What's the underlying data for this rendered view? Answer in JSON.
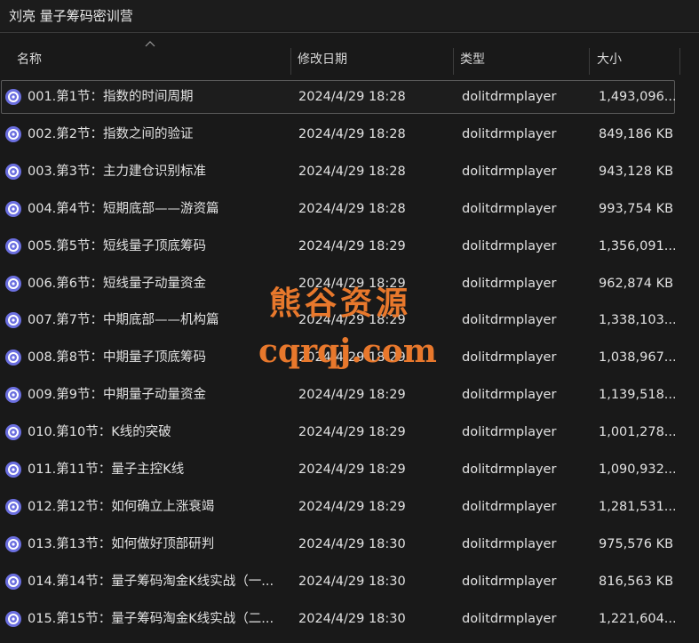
{
  "window": {
    "title": "刘亮 量子筹码密训营"
  },
  "columns": {
    "name": "名称",
    "date": "修改日期",
    "type": "类型",
    "size": "大小"
  },
  "files": [
    {
      "name": "001.第1节：指数的时间周期",
      "date": "2024/4/29 18:28",
      "type": "dolitdrmplayer",
      "size": "1,493,096...",
      "selected": true
    },
    {
      "name": "002.第2节：指数之间的验证",
      "date": "2024/4/29 18:28",
      "type": "dolitdrmplayer",
      "size": "849,186 KB"
    },
    {
      "name": "003.第3节：主力建仓识别标准",
      "date": "2024/4/29 18:28",
      "type": "dolitdrmplayer",
      "size": "943,128 KB"
    },
    {
      "name": "004.第4节：短期底部——游资篇",
      "date": "2024/4/29 18:28",
      "type": "dolitdrmplayer",
      "size": "993,754 KB"
    },
    {
      "name": "005.第5节：短线量子顶底筹码",
      "date": "2024/4/29 18:29",
      "type": "dolitdrmplayer",
      "size": "1,356,091..."
    },
    {
      "name": "006.第6节：短线量子动量资金",
      "date": "2024/4/29 18:29",
      "type": "dolitdrmplayer",
      "size": "962,874 KB"
    },
    {
      "name": "007.第7节：中期底部——机构篇",
      "date": "2024/4/29 18:29",
      "type": "dolitdrmplayer",
      "size": "1,338,103..."
    },
    {
      "name": "008.第8节：中期量子顶底筹码",
      "date": "2024/4/29 18:29",
      "type": "dolitdrmplayer",
      "size": "1,038,967..."
    },
    {
      "name": "009.第9节：中期量子动量资金",
      "date": "2024/4/29 18:29",
      "type": "dolitdrmplayer",
      "size": "1,139,518..."
    },
    {
      "name": "010.第10节：K线的突破",
      "date": "2024/4/29 18:29",
      "type": "dolitdrmplayer",
      "size": "1,001,278..."
    },
    {
      "name": "011.第11节：量子主控K线",
      "date": "2024/4/29 18:29",
      "type": "dolitdrmplayer",
      "size": "1,090,932..."
    },
    {
      "name": "012.第12节：如何确立上涨衰竭",
      "date": "2024/4/29 18:29",
      "type": "dolitdrmplayer",
      "size": "1,281,531..."
    },
    {
      "name": "013.第13节：如何做好顶部研判",
      "date": "2024/4/29 18:30",
      "type": "dolitdrmplayer",
      "size": "975,576 KB"
    },
    {
      "name": "014.第14节：量子筹码淘金K线实战（一...",
      "date": "2024/4/29 18:30",
      "type": "dolitdrmplayer",
      "size": "816,563 KB"
    },
    {
      "name": "015.第15节：量子筹码淘金K线实战（二...",
      "date": "2024/4/29 18:30",
      "type": "dolitdrmplayer",
      "size": "1,221,604..."
    }
  ],
  "watermark": {
    "line1": "熊谷资源",
    "line2": "cqrqj.com"
  },
  "colors": {
    "background": "#191919",
    "text": "#e2e2e2",
    "icon": "#6b6fe0",
    "watermark": "#e8782c"
  },
  "icons": {
    "file": "dolitdrmplayer-file-icon",
    "sort": "sort-ascending-icon"
  }
}
